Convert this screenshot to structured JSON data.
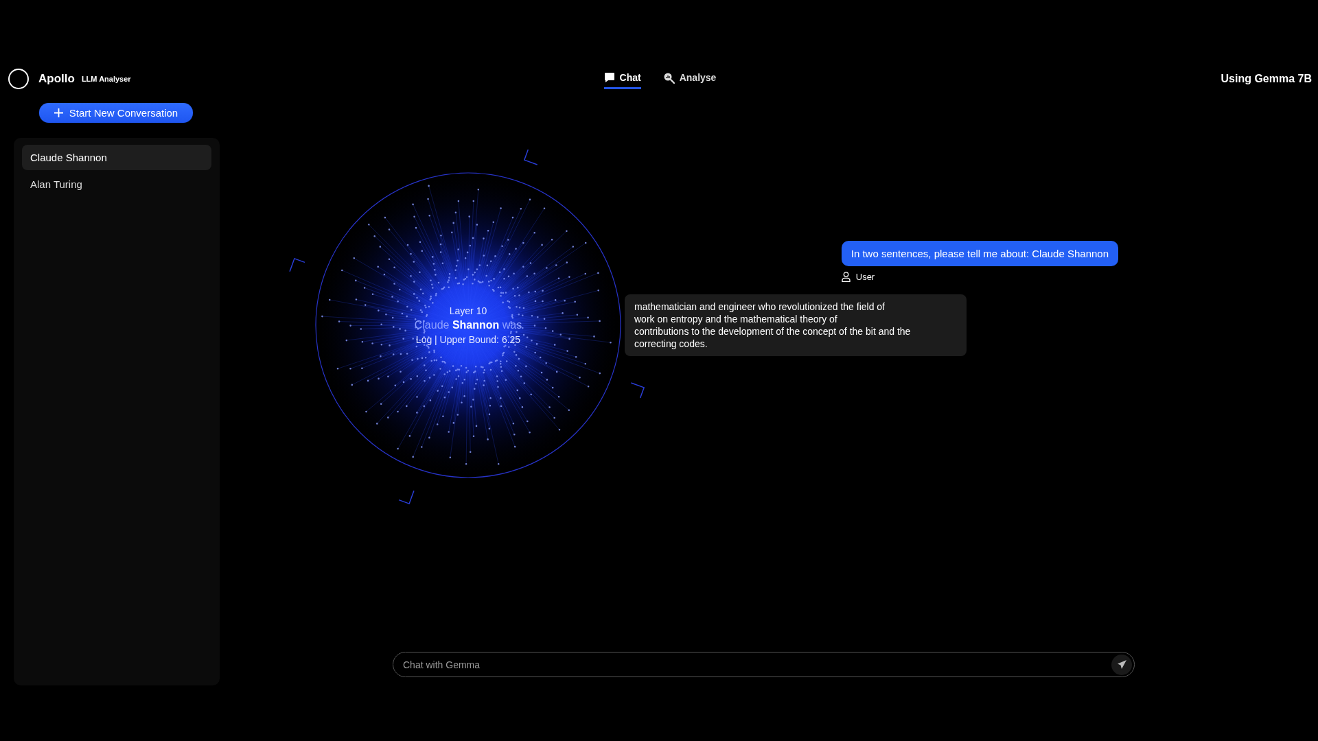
{
  "app": {
    "name": "Apollo",
    "subtitle": "LLM Analyser"
  },
  "tabs": [
    {
      "label": "Chat",
      "kind": "chat",
      "selected": true
    },
    {
      "label": "Analyse",
      "kind": "analyse",
      "selected": false
    }
  ],
  "model_label": "Using Gemma 7B",
  "new_conversation_button": "Start New Conversation",
  "conversations": [
    {
      "title": "Claude Shannon",
      "selected": true
    },
    {
      "title": "Alan Turing",
      "selected": false
    }
  ],
  "visualisation": {
    "layer": "Layer 10",
    "tokens": "Claude **Shannon** was",
    "scale": "Log | Upper Bound: 6.25"
  },
  "messages": [
    {
      "kind": "user",
      "text": "In two sentences, please tell me about: Claude Shannon",
      "author": "User"
    },
    {
      "kind": "assistant",
      "lines": [
        "mathematician and engineer who revolutionized the field of",
        "work on entropy and the mathematical theory of",
        "contributions to the development of the concept of the bit and the",
        "correcting codes."
      ]
    }
  ],
  "input": {
    "placeholder": "Chat with Gemma"
  }
}
